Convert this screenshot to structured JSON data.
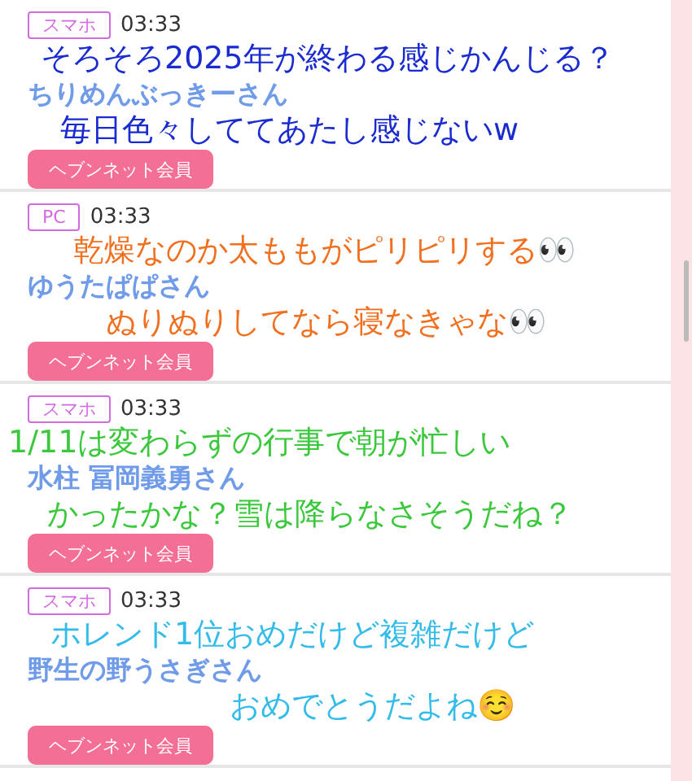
{
  "posts": [
    {
      "device": "スマホ",
      "time": "03:33",
      "name": "ちりめんぶっきーさん",
      "badge": "ヘブンネット会員",
      "comments": [
        {
          "text": "そろそろ2025年が終わる感じかんじる？",
          "color": "#1a2bd0"
        },
        {
          "text": "毎日色々しててあたし感じないw",
          "color": "#1a2bd0"
        }
      ]
    },
    {
      "device": "PC",
      "time": "03:33",
      "name": "ゆうたぱぱさん",
      "badge": "ヘブンネット会員",
      "comments": [
        {
          "text": "乾燥なのか太ももがピリピリする👀",
          "color": "#f07020"
        },
        {
          "text": "ぬりぬりしてなら寝なきゃな👀",
          "color": "#f07020"
        }
      ]
    },
    {
      "device": "スマホ",
      "time": "03:33",
      "name": "水柱 冨岡義勇さん",
      "badge": "ヘブンネット会員",
      "comments": [
        {
          "text": "1/11は変わらずの行事で朝が忙しい",
          "color": "#3cc83c"
        },
        {
          "text": "かったかな？雪は降らなさそうだね？",
          "color": "#3cc83c"
        }
      ]
    },
    {
      "device": "スマホ",
      "time": "03:33",
      "name": "野生の野うさぎさん",
      "badge": "ヘブンネット会員",
      "comments": [
        {
          "text": "ホレンド1位おめだけど複雑だけど",
          "color": "#33bbea"
        },
        {
          "text": "おめでとうだよね☺️",
          "color": "#33bbea"
        }
      ]
    }
  ]
}
